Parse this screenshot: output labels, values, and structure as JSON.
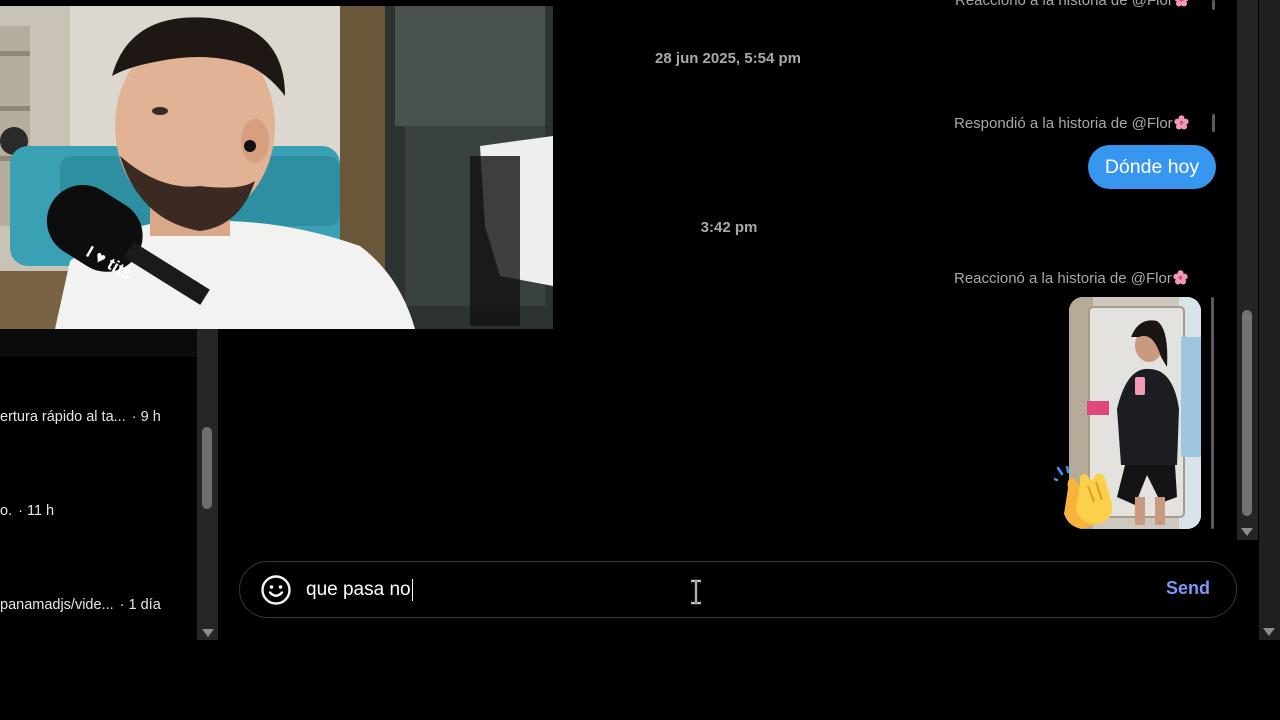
{
  "webcam": {
    "mic_sticker_text": "I ♥ tits"
  },
  "left_list": {
    "items": [
      {
        "snippet": "ertura rápido al ta...",
        "time": "· 9 h"
      },
      {
        "snippet": "o.",
        "time": "· 11 h"
      },
      {
        "snippet": "panamadjs/vide...",
        "time": "· 1 día"
      }
    ]
  },
  "chat": {
    "messages": {
      "top_context": "Reaccionó a la historia de @Flor",
      "date_separator_1": "28 jun 2025, 5:54 pm",
      "reply_context": "Respondió a la historia de @Flor",
      "reply_bubble": "Dónde hoy",
      "date_separator_2": "3:42 pm",
      "reaction_context": "Reaccionó a la historia de @Flor",
      "reaction_emoji": "clapping-hands"
    },
    "colors": {
      "bubble": "#3797f0",
      "send": "#7f96f4",
      "context_text": "#a8a8a8"
    }
  },
  "composer": {
    "value": "que pasa no",
    "send_label": "Send",
    "emoji_icon": "smiley-face-icon"
  }
}
